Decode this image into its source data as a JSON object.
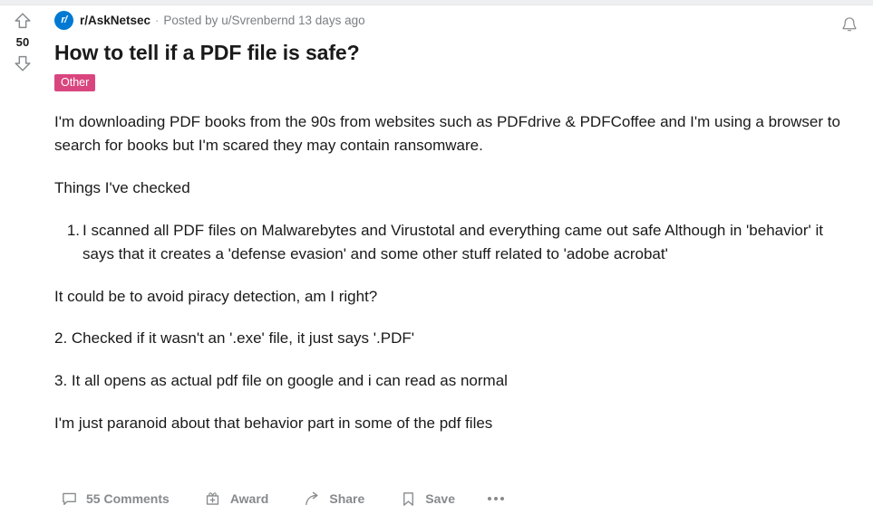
{
  "post": {
    "subreddit": "r/AskNetsec",
    "separator": "·",
    "posted_by_prefix": "Posted by",
    "author": "u/Svrenbernd",
    "timestamp": "13 days ago",
    "avatar_label": "r/",
    "title": "How to tell if a PDF file is safe?",
    "flair": "Other",
    "vote_count": "50",
    "body": {
      "paragraph_1": "I'm downloading PDF books from the 90s from websites such as PDFdrive & PDFCoffee and I'm using a browser to search for books but I'm scared they may contain ransomware.",
      "paragraph_2": "Things I've checked",
      "list_item_1_marker": "1.",
      "list_item_1": "I scanned all PDF files on Malwarebytes and Virustotal and everything came out safe Although in 'behavior' it says that it creates a 'defense evasion' and some other stuff related to 'adobe acrobat'",
      "paragraph_3": "It could be to avoid piracy detection, am I right?",
      "paragraph_4": "2. Checked if it wasn't an '.exe' file, it just says '.PDF'",
      "paragraph_5": "3. It all opens as actual pdf file on google and i can read as normal",
      "paragraph_6": "I'm just paranoid about that behavior part in some of the pdf files"
    }
  },
  "actions": {
    "comments": "55 Comments",
    "award": "Award",
    "share": "Share",
    "save": "Save"
  },
  "colors": {
    "reddit_blue": "#0079d3",
    "flair_pink": "#d9467f",
    "text_primary": "#1a1a1b",
    "text_muted": "#7c7f81",
    "action_gray": "#878a8c"
  }
}
